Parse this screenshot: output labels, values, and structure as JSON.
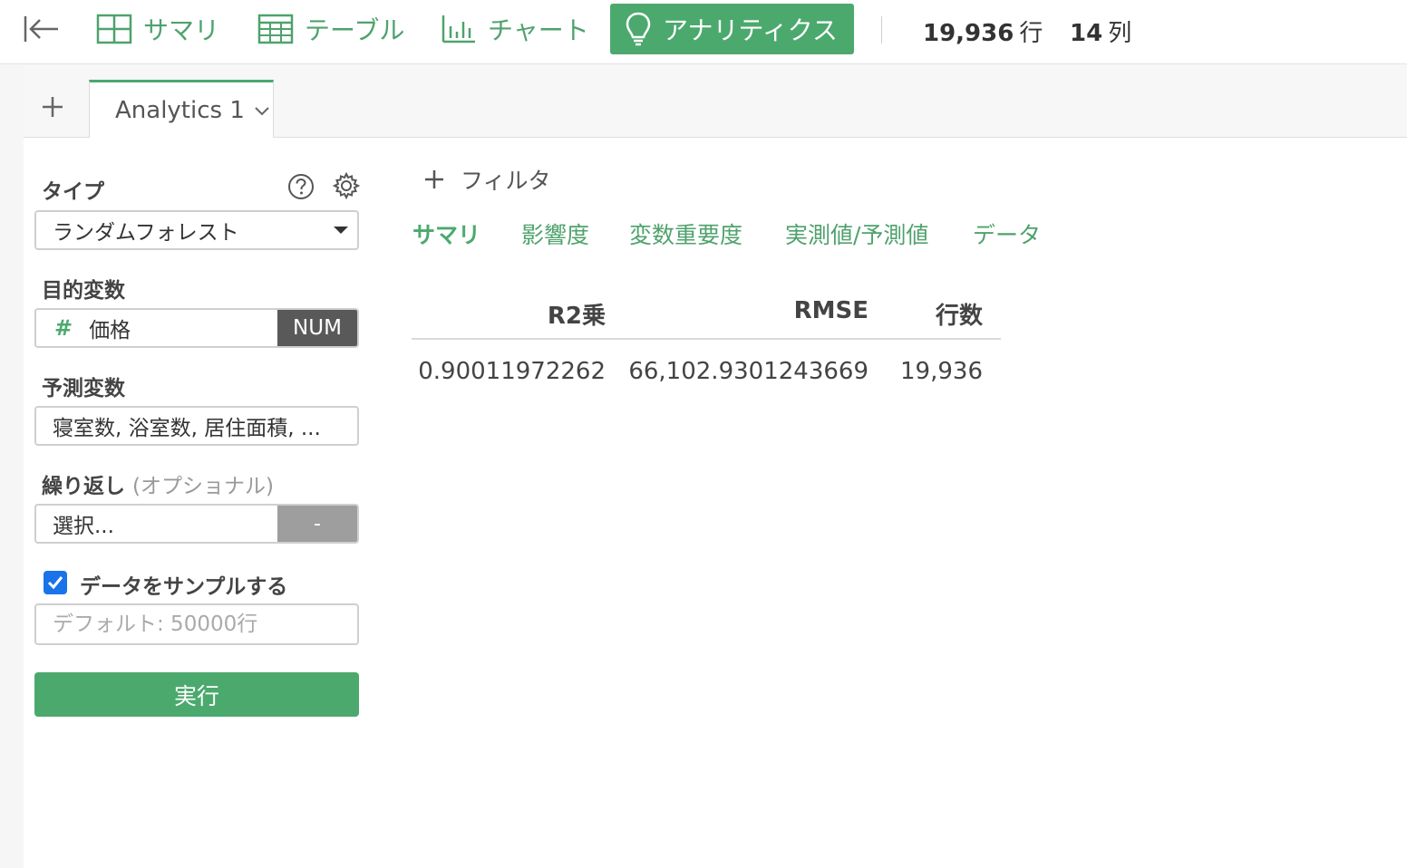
{
  "toolbar": {
    "nav": [
      {
        "label": "サマリ",
        "icon": "grid-icon"
      },
      {
        "label": "テーブル",
        "icon": "table-icon"
      },
      {
        "label": "チャート",
        "icon": "bar-chart-icon"
      },
      {
        "label": "アナリティクス",
        "icon": "lightbulb-icon",
        "active": true
      }
    ],
    "rows_value": "19,936",
    "rows_unit": "行",
    "cols_value": "14",
    "cols_unit": "列"
  },
  "tabs": {
    "items": [
      {
        "label": "Analytics 1",
        "active": true
      }
    ]
  },
  "panel": {
    "type_label": "タイプ",
    "type_value": "ランダムフォレスト",
    "target_label": "目的変数",
    "target_symbol": "#",
    "target_value": "価格",
    "target_type": "NUM",
    "predictors_label": "予測変数",
    "predictors_value": "寝室数, 浴室数, 居住面積, ...",
    "repeat_label": "繰り返し",
    "repeat_optional": "(オプショナル)",
    "repeat_value": "選択...",
    "repeat_button": "-",
    "sample_label": "データをサンプルする",
    "sample_checked": true,
    "sample_placeholder": "デフォルト: 50000行",
    "run_label": "実行"
  },
  "content": {
    "filter_label": "フィルタ",
    "subtabs": [
      {
        "label": "サマリ",
        "active": true
      },
      {
        "label": "影響度"
      },
      {
        "label": "変数重要度"
      },
      {
        "label": "実測値/予測値"
      },
      {
        "label": "データ"
      }
    ],
    "table": {
      "headers": [
        "R2乗",
        "RMSE",
        "行数"
      ],
      "rows": [
        [
          "0.90011972262",
          "66,102.9301243669",
          "19,936"
        ]
      ]
    }
  },
  "colors": {
    "accent": "#4ca96e",
    "badge_dark": "#595959",
    "checkbox": "#1a73e8"
  }
}
